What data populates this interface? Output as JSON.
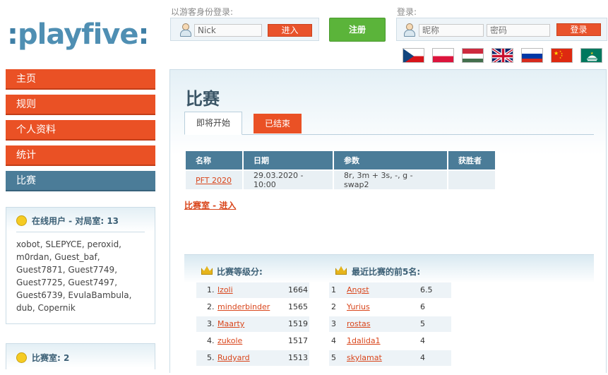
{
  "logo": {
    "text": "playfive",
    "prefix": ":",
    "suffix": ":"
  },
  "guest_login": {
    "label": "以游客身份登录:",
    "name_value": "Nick",
    "enter_button": "进入"
  },
  "register_button": "注册",
  "login": {
    "label": "登录:",
    "nickname_placeholder": "昵称",
    "password_placeholder": "密码",
    "login_button": "登录"
  },
  "flags": [
    "czech-flag",
    "polish-flag",
    "hungarian-flag",
    "uk-flag",
    "russian-flag",
    "chinese-flag",
    "macau-flag"
  ],
  "nav": [
    {
      "label": "主页",
      "active": false
    },
    {
      "label": "规则",
      "active": false
    },
    {
      "label": "个人资料",
      "active": false
    },
    {
      "label": "统计",
      "active": false
    },
    {
      "label": "比赛",
      "active": true
    }
  ],
  "online_panel": {
    "title": "在线用户 - 对局室: 13",
    "users_lines": [
      "xobot, SLEPYCE, peroxid,",
      "m0rdan, Guest_baf,",
      "Guest7871, Guest7749,",
      "Guest7725, Guest7497,",
      "Guest6739, EvulaBambula,",
      "dub, Copernik"
    ]
  },
  "competition_panel": {
    "title": "比赛室: 2"
  },
  "main": {
    "title": "比赛",
    "tabs": [
      {
        "label": "即将开始",
        "active": true
      },
      {
        "label": "已结束",
        "active": false
      }
    ],
    "table": {
      "headers": [
        "名称",
        "日期",
        "参数",
        "获胜者"
      ],
      "rows": [
        [
          "PFT 2020",
          "29.03.2020 - 10:00",
          "8r, 3m + 3s, -, g - swap2",
          ""
        ]
      ]
    },
    "room_link": "比赛室 - 进入"
  },
  "ranking": {
    "title": "比赛等级分:",
    "rows": [
      {
        "rank": "1.",
        "name": "lzoli",
        "score": "1664"
      },
      {
        "rank": "2.",
        "name": "minderbinder",
        "score": "1565"
      },
      {
        "rank": "3.",
        "name": "Maarty",
        "score": "1519"
      },
      {
        "rank": "4.",
        "name": "zukole",
        "score": "1517"
      },
      {
        "rank": "5.",
        "name": "Rudyard",
        "score": "1513"
      }
    ]
  },
  "top5": {
    "title": "最近比赛的前5名:",
    "rows": [
      {
        "rank": "1",
        "name": "Angst",
        "score": "6.5"
      },
      {
        "rank": "2",
        "name": "Yurius",
        "score": "6"
      },
      {
        "rank": "3",
        "name": "rostas",
        "score": "5"
      },
      {
        "rank": "4",
        "name": "1dalida1",
        "score": "4"
      },
      {
        "rank": "5",
        "name": "skylamat",
        "score": "4"
      }
    ]
  }
}
